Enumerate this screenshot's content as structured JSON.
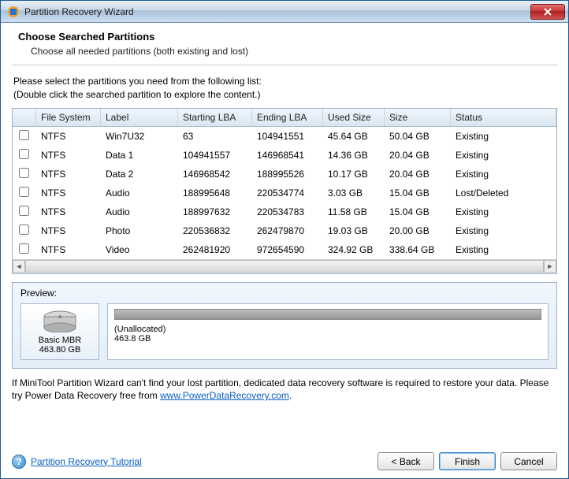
{
  "window": {
    "title": "Partition Recovery Wizard"
  },
  "header": {
    "title": "Choose Searched Partitions",
    "subtitle": "Choose all needed partitions (both existing and lost)"
  },
  "instructions": {
    "line1": "Please select the partitions you need from the following list:",
    "line2": "(Double click the searched partition to explore the content.)"
  },
  "columns": {
    "fs": "File System",
    "label": "Label",
    "slba": "Starting LBA",
    "elba": "Ending LBA",
    "used": "Used Size",
    "size": "Size",
    "status": "Status"
  },
  "rows": [
    {
      "fs": "NTFS",
      "label": "Win7U32",
      "slba": "63",
      "elba": "104941551",
      "used": "45.64 GB",
      "size": "50.04 GB",
      "status": "Existing"
    },
    {
      "fs": "NTFS",
      "label": "Data 1",
      "slba": "104941557",
      "elba": "146968541",
      "used": "14.36 GB",
      "size": "20.04 GB",
      "status": "Existing"
    },
    {
      "fs": "NTFS",
      "label": "Data 2",
      "slba": "146968542",
      "elba": "188995526",
      "used": "10.17 GB",
      "size": "20.04 GB",
      "status": "Existing"
    },
    {
      "fs": "NTFS",
      "label": "Audio",
      "slba": "188995648",
      "elba": "220534774",
      "used": "3.03 GB",
      "size": "15.04 GB",
      "status": "Lost/Deleted"
    },
    {
      "fs": "NTFS",
      "label": "Audio",
      "slba": "188997632",
      "elba": "220534783",
      "used": "11.58 GB",
      "size": "15.04 GB",
      "status": "Existing"
    },
    {
      "fs": "NTFS",
      "label": "Photo",
      "slba": "220536832",
      "elba": "262479870",
      "used": "19.03 GB",
      "size": "20.00 GB",
      "status": "Existing"
    },
    {
      "fs": "NTFS",
      "label": "Video",
      "slba": "262481920",
      "elba": "972654590",
      "used": "324.92 GB",
      "size": "338.64 GB",
      "status": "Existing"
    }
  ],
  "preview": {
    "label": "Preview:",
    "disk_name": "Basic MBR",
    "disk_size": "463.80 GB",
    "part_label": "(Unallocated)",
    "part_size": "463.8 GB"
  },
  "note": {
    "text1": "If MiniTool Partition Wizard can't find your lost partition, dedicated data recovery software is required to restore your data. Please try Power Data Recovery free from ",
    "link": "www.PowerDataRecovery.com",
    "text2": "."
  },
  "footer": {
    "help_link": "Partition Recovery Tutorial",
    "back": "< Back",
    "finish": "Finish",
    "cancel": "Cancel"
  }
}
